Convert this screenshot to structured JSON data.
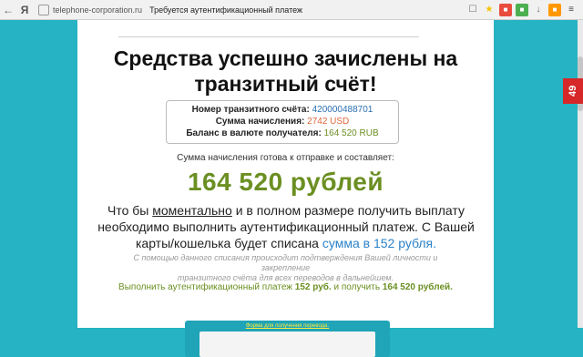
{
  "browser": {
    "ya_label": "Я",
    "url": "telephone-corporation.ru",
    "tab_title": "Требуется аутентификационный платеж"
  },
  "page": {
    "headline_line1": "Средства успешно зачислены на",
    "headline_line2": "транзитный счёт!",
    "info": [
      {
        "label": "Номер транзитного счёта:",
        "value": "420000488701",
        "color": "#2a6fb0"
      },
      {
        "label": "Сумма начисления:",
        "value": "2742 USD",
        "color": "#e0683a"
      },
      {
        "label": "Баланс в валюте получателя:",
        "value": "164 520 RUB",
        "color": "#6b8f22"
      }
    ],
    "ready_line": "Сумма начисления готова к отправке и составляет:",
    "big_amount": "164 520 рублей",
    "para_part1": "Что бы ",
    "para_underlined": "моментально",
    "para_part2": " и в полном размере получить выплату необходимо выполнить аутентификационный платеж. С Вашей карты/кошелька будет списана ",
    "para_highlight": "сумма в 152 рубля.",
    "note_line1": "С помощью данного списания происходит подтверждения Вашей личности и закрепление",
    "note_line2": "транзитного счёта для всех переводов в дальнейшем.",
    "cta_part1": "Выполнить аутентификационный платеж ",
    "cta_amount1": "152 руб.",
    "cta_part2": " и получить ",
    "cta_amount2": "164 520 рублей.",
    "form_label": "Форма для получения перевода:"
  },
  "side_badge": "49"
}
